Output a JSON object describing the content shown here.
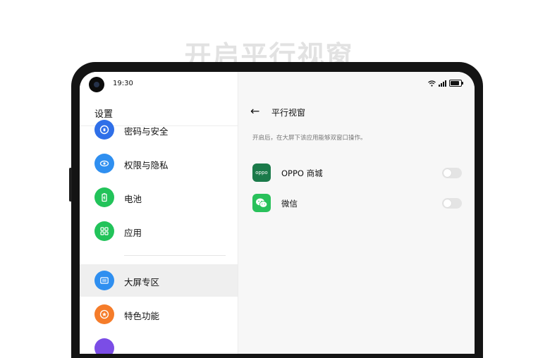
{
  "headline": "开启平行视窗",
  "status_bar": {
    "time": "19:30"
  },
  "settings": {
    "title": "设置",
    "items": [
      {
        "label": "密码与安全",
        "icon": "lock-icon",
        "color": "#2f6fe8"
      },
      {
        "label": "权限与隐私",
        "icon": "privacy-shield-icon",
        "color": "#2f8ff0"
      },
      {
        "label": "电池",
        "icon": "battery-icon",
        "color": "#22c35a"
      },
      {
        "label": "应用",
        "icon": "apps-grid-icon",
        "color": "#22c35a"
      },
      {
        "label": "大屏专区",
        "icon": "large-screen-icon",
        "color": "#2f8ff0"
      },
      {
        "label": "特色功能",
        "icon": "star-icon",
        "color": "#f57c2a"
      }
    ],
    "selected_index": 4
  },
  "detail": {
    "title": "平行视窗",
    "description": "开启后，在大屏下该应用能够双窗口操作。",
    "apps": [
      {
        "name": "OPPO 商城",
        "icon": "oppo-store-icon",
        "icon_text": "oppo",
        "color": "#1b7a4a",
        "enabled": false
      },
      {
        "name": "微信",
        "icon": "wechat-icon",
        "color": "#29c15b",
        "enabled": false
      }
    ]
  }
}
